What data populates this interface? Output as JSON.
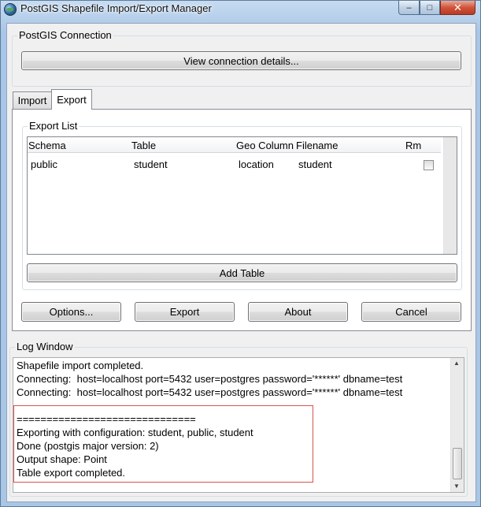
{
  "window": {
    "title": "PostGIS Shapefile Import/Export Manager",
    "controls": {
      "minimize": "–",
      "maximize": "□",
      "close": "✕"
    }
  },
  "connection": {
    "group_label": "PostGIS Connection",
    "view_button": "View connection details..."
  },
  "tabs": [
    {
      "label": "Import",
      "active": false
    },
    {
      "label": "Export",
      "active": true
    }
  ],
  "export_list": {
    "group_label": "Export List",
    "columns": [
      "Schema",
      "Table",
      "Geo Column",
      "Filename",
      "Rm"
    ],
    "rows": [
      {
        "schema": "public",
        "table": "student",
        "geo_column": "location",
        "filename": "student",
        "rm": false
      }
    ],
    "add_button": "Add Table"
  },
  "actions": {
    "options": "Options...",
    "export": "Export",
    "about": "About",
    "cancel": "Cancel"
  },
  "log": {
    "group_label": "Log Window",
    "lines": [
      "Shapefile import completed.",
      "Connecting:  host=localhost port=5432 user=postgres password='******' dbname=test",
      "Connecting:  host=localhost port=5432 user=postgres password='******' dbname=test",
      "",
      "==============================",
      "Exporting with configuration: student, public, student",
      "Done (postgis major version: 2)",
      "Output shape: Point",
      "Table export completed."
    ]
  },
  "colors": {
    "highlight_border": "#d9534f",
    "title_bar": "#a9c6e6"
  }
}
